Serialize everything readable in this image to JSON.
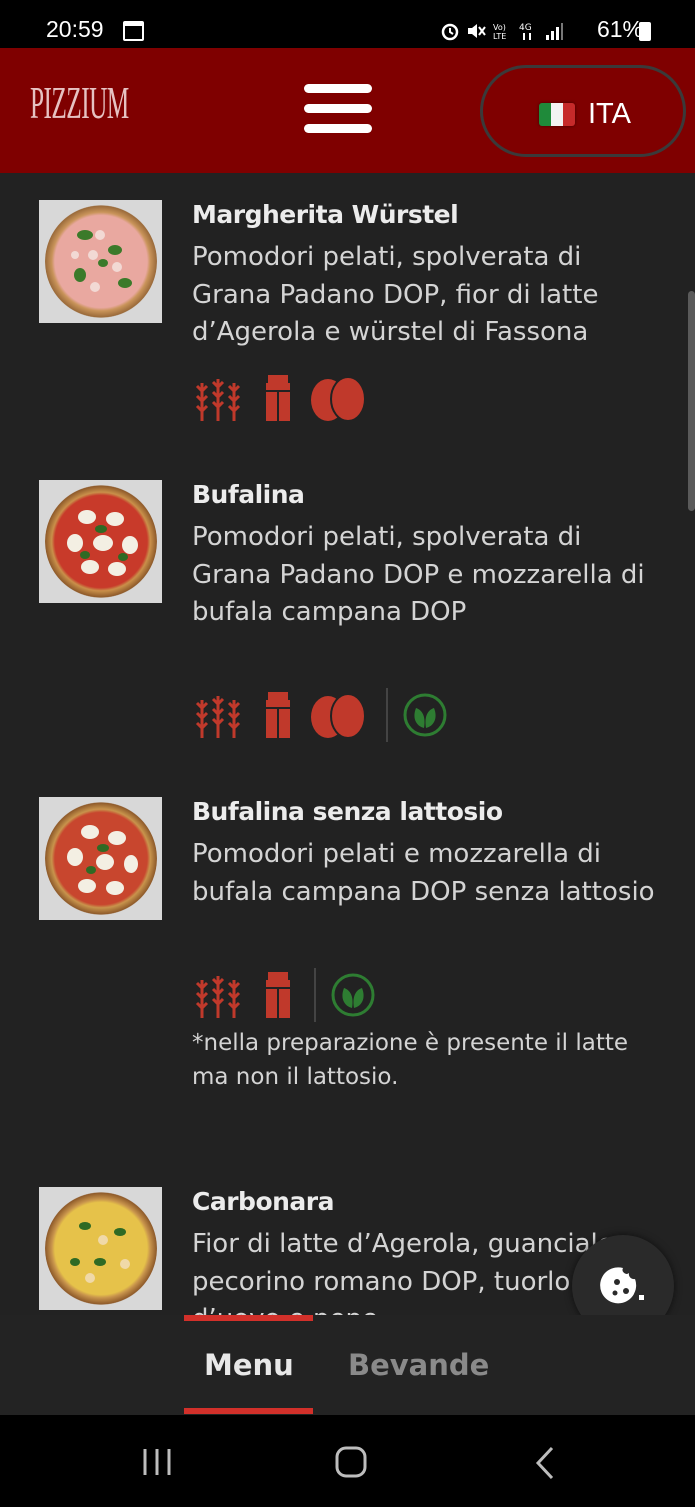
{
  "status_bar": {
    "time": "20:59",
    "battery": "61%"
  },
  "header": {
    "logo": "PIZZIUM",
    "language": "ITA"
  },
  "menu_items": [
    {
      "title": "Margherita Würstel",
      "description": "Pomodori pelati, spolverata di Grana Padano DOP, fior di latte d’Agerola e würstel di Fassona",
      "allergens": [
        "wheat-icon",
        "milk-icon",
        "egg-icon"
      ],
      "vegetarian": false
    },
    {
      "title": "Bufalina",
      "description": "Pomodori pelati, spolverata di Grana Padano DOP e mozzarella di bufala campana DOP",
      "allergens": [
        "wheat-icon",
        "milk-icon",
        "egg-icon"
      ],
      "vegetarian": true
    },
    {
      "title": "Bufalina senza lattosio",
      "description": "Pomodori pelati e mozzarella di bufala campana DOP senza lattosio",
      "allergens": [
        "wheat-icon",
        "milk-icon"
      ],
      "vegetarian": true,
      "note": "*nella preparazione è presente il latte ma non il lattosio."
    },
    {
      "title": "Carbonara",
      "description": "Fior di latte d’Agerola, guanciale, pecorino romano DOP, tuorlo d’uovo e pepe"
    }
  ],
  "tabs": {
    "menu": "Menu",
    "drinks": "Bevande"
  },
  "colors": {
    "header": "#7f0000",
    "accent": "#d2302a",
    "allergen": "#c0392b",
    "veg": "#2e7d32",
    "background": "#222222"
  }
}
